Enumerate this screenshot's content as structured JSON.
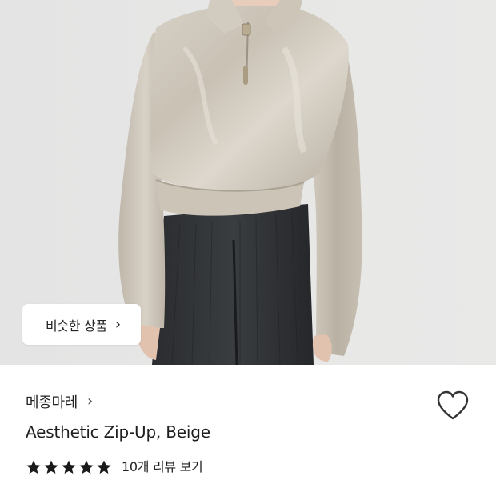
{
  "photo": {
    "alt_subject": "model-wearing-satin-zip-up-top"
  },
  "similar_button": {
    "label": "비슷한 상품",
    "chevron": "›"
  },
  "brand": {
    "name": "메종마레",
    "chevron": "›"
  },
  "product": {
    "name": "Aesthetic Zip-Up, Beige"
  },
  "rating": {
    "stars": 5,
    "max_stars": 5,
    "reviews_label": "10개 리뷰 보기"
  },
  "icons": {
    "wishlist": "heart-outline-icon",
    "star": "star-filled-icon"
  },
  "colors": {
    "text": "#222222",
    "photo_bg": "#e6e6e6",
    "heart_stroke": "#333333"
  }
}
